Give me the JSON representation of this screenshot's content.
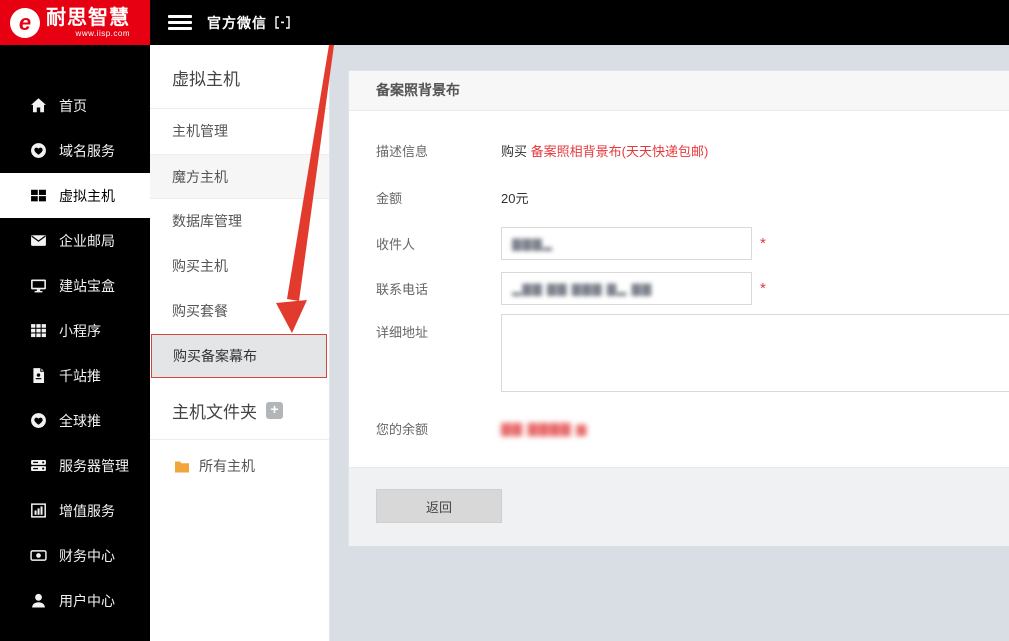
{
  "brand": {
    "name": "耐思智慧",
    "url": "www.iisp.com",
    "logo_letter": "e",
    "brand_red": "#e60012"
  },
  "topbar": {
    "wechat_label": "官方微信"
  },
  "sidebar": {
    "items": [
      {
        "label": "首页",
        "icon": "home-icon",
        "active": false
      },
      {
        "label": "域名服务",
        "icon": "heart-globe-icon",
        "active": false
      },
      {
        "label": "虚拟主机",
        "icon": "windows-icon",
        "active": true
      },
      {
        "label": "企业邮局",
        "icon": "envelope-icon",
        "active": false
      },
      {
        "label": "建站宝盒",
        "icon": "desktop-icon",
        "active": false
      },
      {
        "label": "小程序",
        "icon": "grid-icon",
        "active": false
      },
      {
        "label": "千站推",
        "icon": "file-icon",
        "active": false
      },
      {
        "label": "全球推",
        "icon": "heart-globe-icon",
        "active": false
      },
      {
        "label": "服务器管理",
        "icon": "server-icon",
        "active": false
      },
      {
        "label": "增值服务",
        "icon": "chart-icon",
        "active": false
      },
      {
        "label": "财务中心",
        "icon": "money-icon",
        "active": false
      },
      {
        "label": "用户中心",
        "icon": "user-icon",
        "active": false
      }
    ]
  },
  "submenu": {
    "title": "虚拟主机",
    "items": [
      {
        "label": "主机管理"
      },
      {
        "label": "魔方主机"
      },
      {
        "label": "数据库管理"
      },
      {
        "label": "购买主机"
      },
      {
        "label": "购买套餐"
      },
      {
        "label": "购买备案幕布"
      }
    ],
    "active_item": "购买备案幕布",
    "folder_section_title": "主机文件夹",
    "plus_label": "+",
    "all_hosts_label": "所有主机"
  },
  "panel": {
    "title": "备案照背景布",
    "desc": {
      "label": "描述信息",
      "prefix": "购买 ",
      "highlight": "备案照相背景布(天天快递包邮)"
    },
    "amount": {
      "label": "金额",
      "value": "20元"
    },
    "recipient": {
      "label": "收件人",
      "masked_value": "▇▇▇▂",
      "required_mark": "*"
    },
    "phone": {
      "label": "联系电话",
      "masked_value": "▂▇▇ ▇▇ ▇▇▇ ▇▂ ▇▇",
      "required_mark": "*"
    },
    "address": {
      "label": "详细地址",
      "value": ""
    },
    "balance": {
      "label": "您的余额",
      "masked_value": "▇▇ ▇▇▇▇  ▆"
    },
    "back_button_label": "返回"
  },
  "colors": {
    "brand_red": "#e60012",
    "highlight_red": "#e4393c",
    "arrow_red": "#e23a2c",
    "active_border_red": "#d2453e",
    "folder_yellow": "#f0a63c",
    "page_background": "#d9dee4"
  }
}
